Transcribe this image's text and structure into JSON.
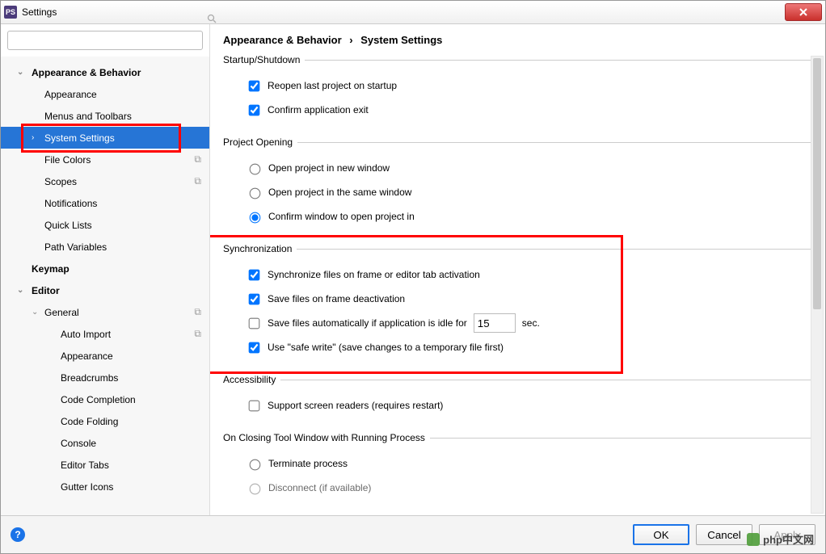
{
  "window": {
    "title": "Settings",
    "app_icon_text": "PS"
  },
  "sidebar": {
    "search_placeholder": "",
    "items": [
      {
        "label": "Appearance & Behavior",
        "level": 1,
        "expanded": true
      },
      {
        "label": "Appearance",
        "level": 2
      },
      {
        "label": "Menus and Toolbars",
        "level": 2
      },
      {
        "label": "System Settings",
        "level": 2,
        "selected": true,
        "expandable": true
      },
      {
        "label": "File Colors",
        "level": 2,
        "linkicon": true
      },
      {
        "label": "Scopes",
        "level": 2,
        "linkicon": true
      },
      {
        "label": "Notifications",
        "level": 2
      },
      {
        "label": "Quick Lists",
        "level": 2
      },
      {
        "label": "Path Variables",
        "level": 2
      },
      {
        "label": "Keymap",
        "level": 1
      },
      {
        "label": "Editor",
        "level": 1,
        "expanded": true
      },
      {
        "label": "General",
        "level": 2,
        "expanded": true,
        "expandable": true,
        "linkicon": true
      },
      {
        "label": "Auto Import",
        "level": 3,
        "linkicon": true
      },
      {
        "label": "Appearance",
        "level": 3
      },
      {
        "label": "Breadcrumbs",
        "level": 3
      },
      {
        "label": "Code Completion",
        "level": 3
      },
      {
        "label": "Code Folding",
        "level": 3
      },
      {
        "label": "Console",
        "level": 3
      },
      {
        "label": "Editor Tabs",
        "level": 3
      },
      {
        "label": "Gutter Icons",
        "level": 3
      }
    ]
  },
  "breadcrumb": {
    "a": "Appearance & Behavior",
    "sep": "›",
    "b": "System Settings"
  },
  "sections": {
    "startup": {
      "title": "Startup/Shutdown",
      "opt1": "Reopen last project on startup",
      "opt2": "Confirm application exit"
    },
    "opening": {
      "title": "Project Opening",
      "opt1": "Open project in new window",
      "opt2": "Open project in the same window",
      "opt3": "Confirm window to open project in"
    },
    "sync": {
      "title": "Synchronization",
      "opt1": "Synchronize files on frame or editor tab activation",
      "opt2": "Save files on frame deactivation",
      "opt3a": "Save files automatically if application is idle for",
      "opt3_value": "15",
      "opt3b": "sec.",
      "opt4": "Use \"safe write\" (save changes to a temporary file first)"
    },
    "access": {
      "title": "Accessibility",
      "opt1": "Support screen readers (requires restart)"
    },
    "closing": {
      "title": "On Closing Tool Window with Running Process",
      "opt1": "Terminate process",
      "opt2": "Disconnect (if available)"
    }
  },
  "footer": {
    "ok": "OK",
    "cancel": "Cancel",
    "apply": "Apply"
  },
  "watermark": "php中文网"
}
